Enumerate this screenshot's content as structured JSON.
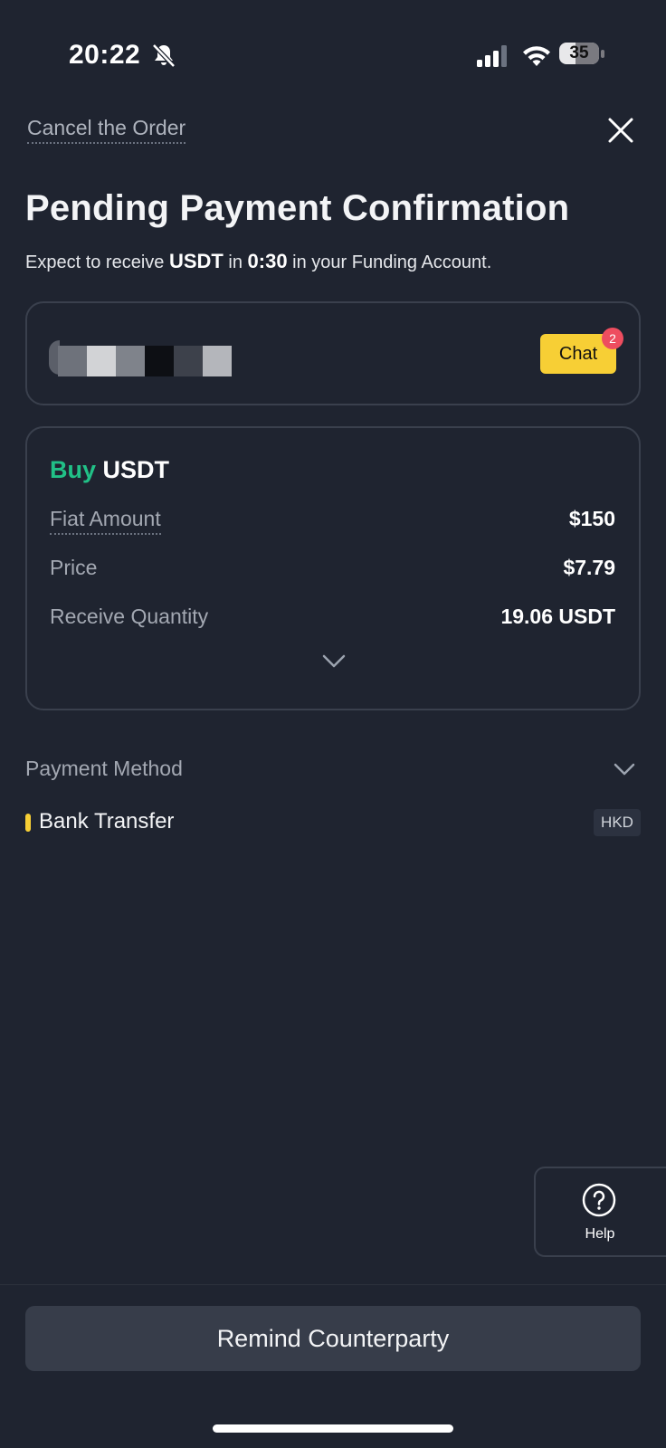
{
  "status_bar": {
    "time": "20:22",
    "battery": "35",
    "icons": [
      "bell-slash-icon",
      "cellular-signal-icon",
      "wifi-icon",
      "battery-icon"
    ]
  },
  "header": {
    "cancel_label": "Cancel the Order",
    "close_icon": "close-icon",
    "title": "Pending Payment Confirmation",
    "subtitle_prefix": "Expect to receive ",
    "subtitle_asset": "USDT",
    "subtitle_middle": " in ",
    "subtitle_time": "0:30",
    "subtitle_suffix": " in your Funding Account."
  },
  "counterparty": {
    "chat_label": "Chat",
    "chat_badge": "2"
  },
  "order": {
    "side": "Buy",
    "asset": "USDT",
    "rows": [
      {
        "label": "Fiat Amount",
        "value": "$150"
      },
      {
        "label": "Price",
        "value": "$7.79"
      },
      {
        "label": "Receive Quantity",
        "value": "19.06 USDT"
      }
    ],
    "expand_icon": "chevron-down-icon"
  },
  "payment": {
    "section_label": "Payment Method",
    "method_name": "Bank Transfer",
    "currency_tag": "HKD"
  },
  "help": {
    "label": "Help",
    "icon": "question-circle-icon"
  },
  "footer": {
    "remind_label": "Remind Counterparty"
  },
  "colors": {
    "background": "#1f2430",
    "buy_green": "#21c187",
    "chat_yellow": "#f7cf35",
    "badge_red": "#ee4d5f",
    "button_bg": "#373d4a"
  }
}
